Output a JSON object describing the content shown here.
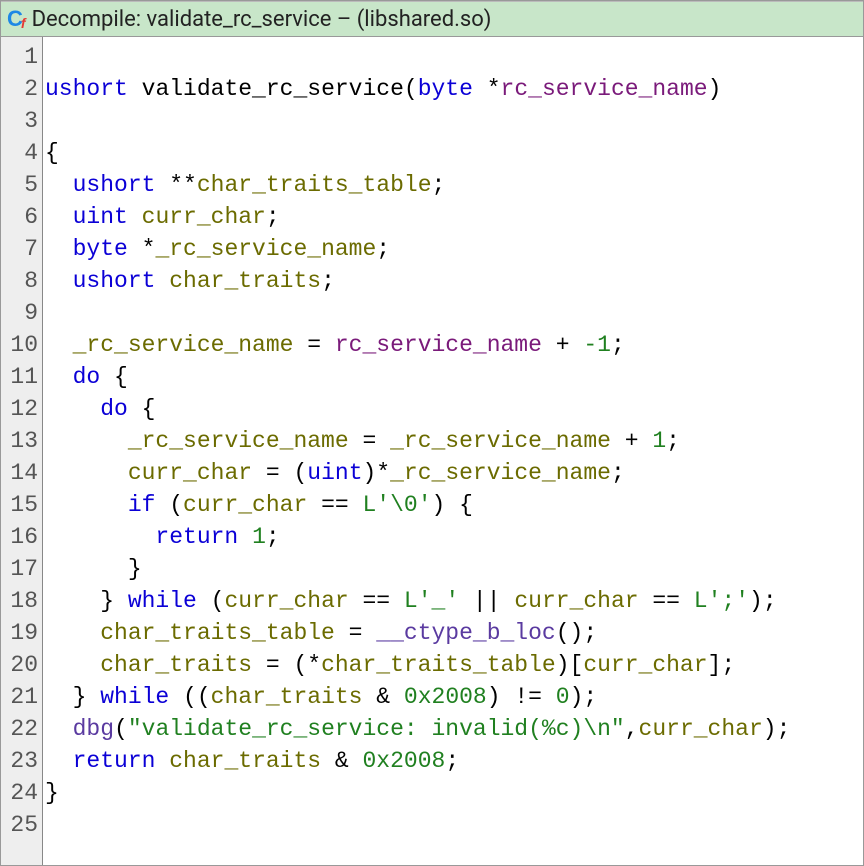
{
  "title": {
    "prefix": "Decompile: ",
    "func": "validate_rc_service",
    "suffix": " –  (libshared.so)"
  },
  "icon_name": "cf-icon",
  "lines": [
    {
      "n": 1,
      "tokens": []
    },
    {
      "n": 2,
      "tokens": [
        {
          "t": "ushort",
          "c": "tk-type"
        },
        {
          "t": " "
        },
        {
          "t": "validate_rc_service",
          "c": "tk-func"
        },
        {
          "t": "("
        },
        {
          "t": "byte",
          "c": "tk-type"
        },
        {
          "t": " *"
        },
        {
          "t": "rc_service_name",
          "c": "tk-param"
        },
        {
          "t": ")"
        }
      ]
    },
    {
      "n": 3,
      "tokens": []
    },
    {
      "n": 4,
      "tokens": [
        {
          "t": "{"
        }
      ]
    },
    {
      "n": 5,
      "tokens": [
        {
          "t": "  "
        },
        {
          "t": "ushort",
          "c": "tk-type"
        },
        {
          "t": " **"
        },
        {
          "t": "char_traits_table",
          "c": "tk-var"
        },
        {
          "t": ";"
        }
      ]
    },
    {
      "n": 6,
      "tokens": [
        {
          "t": "  "
        },
        {
          "t": "uint",
          "c": "tk-type"
        },
        {
          "t": " "
        },
        {
          "t": "curr_char",
          "c": "tk-var"
        },
        {
          "t": ";"
        }
      ]
    },
    {
      "n": 7,
      "tokens": [
        {
          "t": "  "
        },
        {
          "t": "byte",
          "c": "tk-type"
        },
        {
          "t": " *"
        },
        {
          "t": "_rc_service_name",
          "c": "tk-var"
        },
        {
          "t": ";"
        }
      ]
    },
    {
      "n": 8,
      "tokens": [
        {
          "t": "  "
        },
        {
          "t": "ushort",
          "c": "tk-type"
        },
        {
          "t": " "
        },
        {
          "t": "char_traits",
          "c": "tk-var"
        },
        {
          "t": ";"
        }
      ]
    },
    {
      "n": 9,
      "tokens": []
    },
    {
      "n": 10,
      "tokens": [
        {
          "t": "  "
        },
        {
          "t": "_rc_service_name",
          "c": "tk-var"
        },
        {
          "t": " = "
        },
        {
          "t": "rc_service_name",
          "c": "tk-param"
        },
        {
          "t": " + "
        },
        {
          "t": "-1",
          "c": "tk-lit"
        },
        {
          "t": ";"
        }
      ]
    },
    {
      "n": 11,
      "tokens": [
        {
          "t": "  "
        },
        {
          "t": "do",
          "c": "tk-kw"
        },
        {
          "t": " {"
        }
      ]
    },
    {
      "n": 12,
      "tokens": [
        {
          "t": "    "
        },
        {
          "t": "do",
          "c": "tk-kw"
        },
        {
          "t": " {"
        }
      ]
    },
    {
      "n": 13,
      "tokens": [
        {
          "t": "      "
        },
        {
          "t": "_rc_service_name",
          "c": "tk-var"
        },
        {
          "t": " = "
        },
        {
          "t": "_rc_service_name",
          "c": "tk-var"
        },
        {
          "t": " + "
        },
        {
          "t": "1",
          "c": "tk-lit"
        },
        {
          "t": ";"
        }
      ]
    },
    {
      "n": 14,
      "tokens": [
        {
          "t": "      "
        },
        {
          "t": "curr_char",
          "c": "tk-var"
        },
        {
          "t": " = ("
        },
        {
          "t": "uint",
          "c": "tk-type"
        },
        {
          "t": ")*"
        },
        {
          "t": "_rc_service_name",
          "c": "tk-var"
        },
        {
          "t": ";"
        }
      ]
    },
    {
      "n": 15,
      "tokens": [
        {
          "t": "      "
        },
        {
          "t": "if",
          "c": "tk-kw"
        },
        {
          "t": " ("
        },
        {
          "t": "curr_char",
          "c": "tk-var"
        },
        {
          "t": " == "
        },
        {
          "t": "L'\\0'",
          "c": "tk-lit"
        },
        {
          "t": ") {"
        }
      ]
    },
    {
      "n": 16,
      "tokens": [
        {
          "t": "        "
        },
        {
          "t": "return",
          "c": "tk-kw"
        },
        {
          "t": " "
        },
        {
          "t": "1",
          "c": "tk-lit"
        },
        {
          "t": ";"
        }
      ]
    },
    {
      "n": 17,
      "tokens": [
        {
          "t": "      }"
        }
      ]
    },
    {
      "n": 18,
      "tokens": [
        {
          "t": "    } "
        },
        {
          "t": "while",
          "c": "tk-kw"
        },
        {
          "t": " ("
        },
        {
          "t": "curr_char",
          "c": "tk-var"
        },
        {
          "t": " == "
        },
        {
          "t": "L'_'",
          "c": "tk-lit"
        },
        {
          "t": " || "
        },
        {
          "t": "curr_char",
          "c": "tk-var"
        },
        {
          "t": " == "
        },
        {
          "t": "L';'",
          "c": "tk-lit"
        },
        {
          "t": ");"
        }
      ]
    },
    {
      "n": 19,
      "tokens": [
        {
          "t": "    "
        },
        {
          "t": "char_traits_table",
          "c": "tk-var"
        },
        {
          "t": " = "
        },
        {
          "t": "__ctype_b_loc",
          "c": "tk-glob"
        },
        {
          "t": "();"
        }
      ]
    },
    {
      "n": 20,
      "tokens": [
        {
          "t": "    "
        },
        {
          "t": "char_traits",
          "c": "tk-var"
        },
        {
          "t": " = (*"
        },
        {
          "t": "char_traits_table",
          "c": "tk-var"
        },
        {
          "t": ")["
        },
        {
          "t": "curr_char",
          "c": "tk-var"
        },
        {
          "t": "];"
        }
      ]
    },
    {
      "n": 21,
      "tokens": [
        {
          "t": "  } "
        },
        {
          "t": "while",
          "c": "tk-kw"
        },
        {
          "t": " (("
        },
        {
          "t": "char_traits",
          "c": "tk-var"
        },
        {
          "t": " & "
        },
        {
          "t": "0x2008",
          "c": "tk-lit"
        },
        {
          "t": ") != "
        },
        {
          "t": "0",
          "c": "tk-lit"
        },
        {
          "t": ");"
        }
      ]
    },
    {
      "n": 22,
      "tokens": [
        {
          "t": "  "
        },
        {
          "t": "dbg",
          "c": "tk-glob"
        },
        {
          "t": "("
        },
        {
          "t": "\"validate_rc_service: invalid(%c)\\n\"",
          "c": "tk-lit"
        },
        {
          "t": ","
        },
        {
          "t": "curr_char",
          "c": "tk-var"
        },
        {
          "t": ");"
        }
      ]
    },
    {
      "n": 23,
      "tokens": [
        {
          "t": "  "
        },
        {
          "t": "return",
          "c": "tk-kw"
        },
        {
          "t": " "
        },
        {
          "t": "char_traits",
          "c": "tk-var"
        },
        {
          "t": " & "
        },
        {
          "t": "0x2008",
          "c": "tk-lit"
        },
        {
          "t": ";"
        }
      ]
    },
    {
      "n": 24,
      "tokens": [
        {
          "t": "}"
        }
      ]
    },
    {
      "n": 25,
      "tokens": []
    }
  ]
}
